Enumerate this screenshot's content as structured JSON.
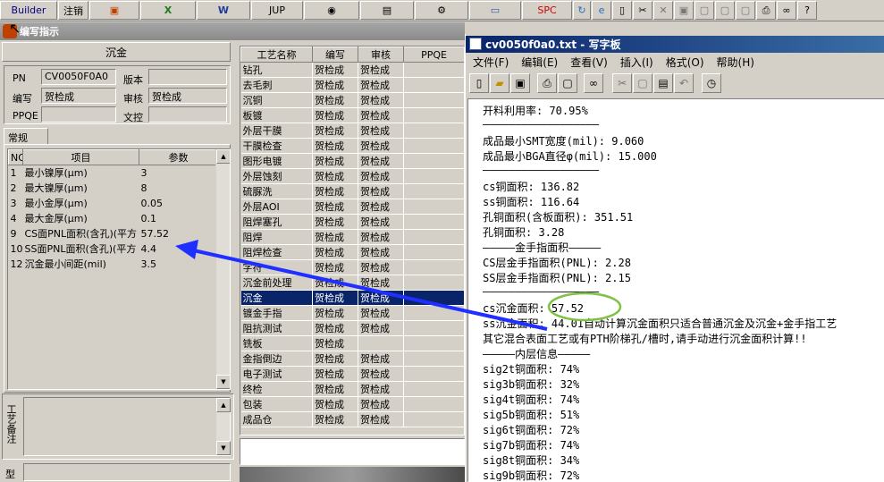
{
  "toolbar": {
    "builder": "Builder",
    "logout": "注销",
    "jup": "JUP",
    "spc": "SPC",
    "word_icon_letter": "W",
    "excel_icon_letter": "X"
  },
  "dialog": {
    "title": "编写指示",
    "section_title": "沉金",
    "pn_label": "PN",
    "pn_value": "CV0050F0A0",
    "version_label": "版本",
    "version_value": "",
    "author_label": "编写",
    "author_value": "贺检成",
    "review_label": "审核",
    "review_value": "贺检成",
    "ppqe_label": "PPQE",
    "ppqe_value": "",
    "wenkong_label": "文控",
    "wenkong_value": "",
    "tab_general": "常规",
    "note_label": "工艺备注",
    "type_label": "型"
  },
  "params": {
    "headers": [
      "NO",
      "项目",
      "参数"
    ],
    "rows": [
      {
        "no": "1",
        "item": "最小镍厚(μm)",
        "value": "3"
      },
      {
        "no": "2",
        "item": "最大镍厚(μm)",
        "value": "8"
      },
      {
        "no": "3",
        "item": "最小金厚(μm)",
        "value": "0.05"
      },
      {
        "no": "4",
        "item": "最大金厚(μm)",
        "value": "0.1"
      },
      {
        "no": "9",
        "item": "CS面PNL面积(含孔)(平方",
        "value": "57.52"
      },
      {
        "no": "10",
        "item": "SS面PNL面积(含孔)(平方",
        "value": "4.4"
      },
      {
        "no": "12",
        "item": "沉金最小间距(mil)",
        "value": "3.5"
      }
    ]
  },
  "process": {
    "headers": [
      "工艺名称",
      "编写",
      "审核",
      "PPQE"
    ],
    "rows": [
      {
        "name": "钻孔",
        "author": "贺检成",
        "review": "贺检成"
      },
      {
        "name": "去毛刺",
        "author": "贺检成",
        "review": "贺检成"
      },
      {
        "name": "沉铜",
        "author": "贺检成",
        "review": "贺检成"
      },
      {
        "name": "板镀",
        "author": "贺检成",
        "review": "贺检成"
      },
      {
        "name": "外层干膜",
        "author": "贺检成",
        "review": "贺检成"
      },
      {
        "name": "干膜检查",
        "author": "贺检成",
        "review": "贺检成"
      },
      {
        "name": "图形电镀",
        "author": "贺检成",
        "review": "贺检成"
      },
      {
        "name": "外层蚀刻",
        "author": "贺检成",
        "review": "贺检成"
      },
      {
        "name": "硫脲洗",
        "author": "贺检成",
        "review": "贺检成"
      },
      {
        "name": "外层AOI",
        "author": "贺检成",
        "review": "贺检成"
      },
      {
        "name": "阻焊塞孔",
        "author": "贺检成",
        "review": "贺检成"
      },
      {
        "name": "阻焊",
        "author": "贺检成",
        "review": "贺检成"
      },
      {
        "name": "阻焊检查",
        "author": "贺检成",
        "review": "贺检成"
      },
      {
        "name": "字符",
        "author": "贺检成",
        "review": "贺检成"
      },
      {
        "name": "沉金前处理",
        "author": "贺检成",
        "review": "贺检成"
      },
      {
        "name": "沉金",
        "author": "贺检成",
        "review": "贺检成",
        "selected": true
      },
      {
        "name": "镀金手指",
        "author": "贺检成",
        "review": "贺检成"
      },
      {
        "name": "阻抗测试",
        "author": "贺检成",
        "review": "贺检成"
      },
      {
        "name": "铣板",
        "author": "贺检成",
        "review": ""
      },
      {
        "name": "金指倒边",
        "author": "贺检成",
        "review": "贺检成"
      },
      {
        "name": "电子测试",
        "author": "贺检成",
        "review": "贺检成"
      },
      {
        "name": "终检",
        "author": "贺检成",
        "review": "贺检成"
      },
      {
        "name": "包装",
        "author": "贺检成",
        "review": "贺检成"
      },
      {
        "name": "成品仓",
        "author": "贺检成",
        "review": "贺检成"
      }
    ]
  },
  "wordpad": {
    "title": "cv0050f0a0.txt - 写字板",
    "menus": [
      "文件(F)",
      "编辑(E)",
      "查看(V)",
      "插入(I)",
      "格式(O)",
      "帮助(H)"
    ],
    "lines": [
      "开料利用率: 70.95%",
      "——————————————————",
      "成品最小SMT宽度(mil): 9.060",
      "成品最小BGA直径φ(mil): 15.000",
      "——————————————————",
      "cs铜面积: 136.82",
      "ss铜面积: 116.64",
      "孔铜面积(含板面积): 351.51",
      "孔铜面积: 3.28",
      "—————金手指面积—————",
      "CS层金手指面积(PNL): 2.28",
      "SS层金手指面积(PNL): 2.15",
      "——————————————————",
      "cs沉金面积: 57.52",
      "ss沉金面积: 44.01自动计算沉金面积只适合普通沉金及沉金+金手指工艺",
      "其它混合表面工艺或有PTH阶梯孔/槽时,请手动进行沉金面积计算!!",
      "—————内层信息—————",
      "sig2t铜面积: 74%",
      "sig3b铜面积: 32%",
      "sig4t铜面积: 74%",
      "sig5b铜面积: 51%",
      "sig6t铜面积: 72%",
      "sig7b铜面积: 74%",
      "sig8t铜面积: 34%",
      "sig9b铜面积: 72%"
    ]
  },
  "colors": {
    "selection": "#0a246a",
    "arrow": "#1f2fff",
    "highlight_circle": "#7fc241"
  }
}
